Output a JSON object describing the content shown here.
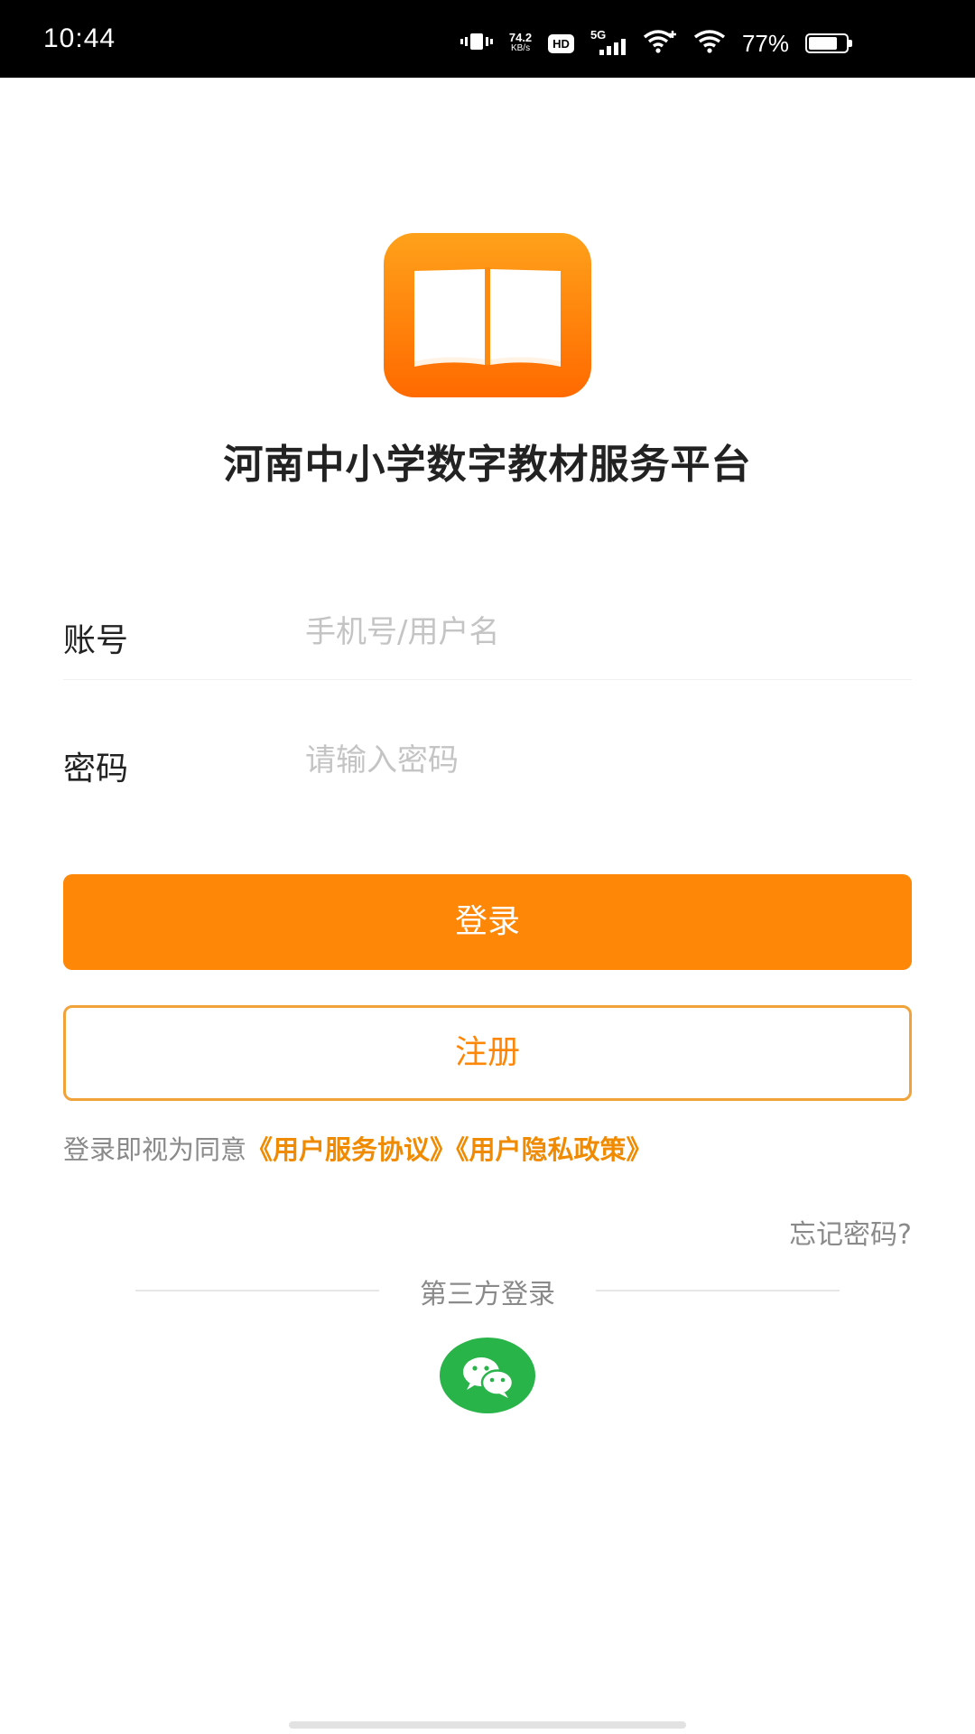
{
  "status_bar": {
    "time": "10:44",
    "net_speed_value": "74.2",
    "net_speed_unit": "KB/s",
    "hd": "HD",
    "network": "5G",
    "battery_percent": "77%",
    "battery_level": 0.77
  },
  "app": {
    "logo_icon": "open-book-icon",
    "title": "河南中小学数字教材服务平台",
    "accent_color": "#ff8708"
  },
  "form": {
    "account_label": "账号",
    "account_placeholder": "手机号/用户名",
    "account_value": "",
    "password_label": "密码",
    "password_placeholder": "请输入密码",
    "password_value": ""
  },
  "buttons": {
    "login": "登录",
    "register": "注册"
  },
  "agreement": {
    "prefix": "登录即视为同意",
    "user_agreement": "《用户服务协议》",
    "privacy_policy": "《用户隐私政策》"
  },
  "forgot_password": "忘记密码?",
  "third_party": {
    "label": "第三方登录",
    "wechat_icon": "wechat-icon"
  }
}
